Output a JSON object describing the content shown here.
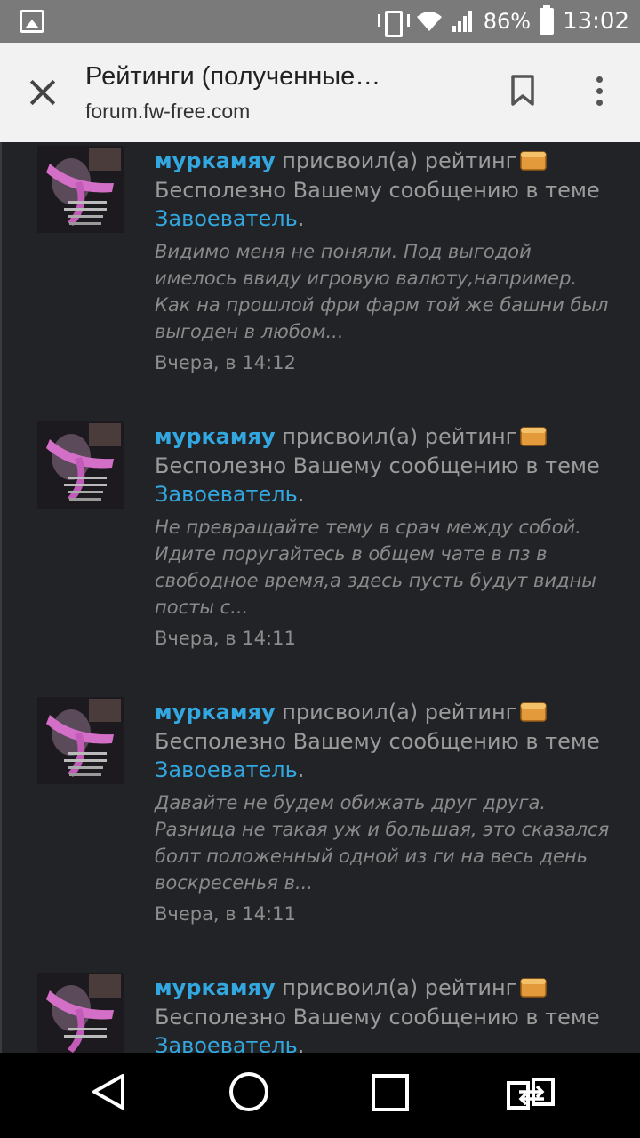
{
  "status_bar": {
    "battery_percent": "86%",
    "time": "13:02"
  },
  "toolbar": {
    "title": "Рейтинги (полученные…",
    "url": "forum.fw-free.com"
  },
  "items": [
    {
      "user": "муркамяу",
      "action": " присвоил(а) рейтинг",
      "line2_prefix": "Бесполезно Вашему сообщению в теме",
      "topic": "Завоеватель",
      "topic_suffix": ".",
      "quote": "Видимо меня не поняли. Под выгодой имелось ввиду игровую валюту,например. Как на прошлой фри фарм той же башни был выгоден в любом...",
      "date": "Вчера, в 14:12"
    },
    {
      "user": "муркамяу",
      "action": " присвоил(а) рейтинг",
      "line2_prefix": "Бесполезно Вашему сообщению в теме",
      "topic": "Завоеватель",
      "topic_suffix": ".",
      "quote": "Не превращайте тему в срач между собой. Идите поругайтесь в общем чате в пз в свободное время,а здесь пусть будут видны посты с...",
      "date": "Вчера, в 14:11"
    },
    {
      "user": "муркамяу",
      "action": " присвоил(а) рейтинг",
      "line2_prefix": "Бесполезно Вашему сообщению в теме",
      "topic": "Завоеватель",
      "topic_suffix": ".",
      "quote": "Давайте не будем обижать друг друга. Разница не такая уж и большая, это сказался болт положенный одной из ги на весь день воскресенья в...",
      "date": "Вчера, в 14:11"
    },
    {
      "user": "муркамяу",
      "action": " присвоил(а) рейтинг",
      "line2_prefix": "Бесполезно Вашему сообщению в теме",
      "topic": "Завоеватель",
      "topic_suffix": ".",
      "quote": "",
      "date": ""
    }
  ],
  "colors": {
    "accent": "#33a8e0",
    "background": "#222327"
  }
}
